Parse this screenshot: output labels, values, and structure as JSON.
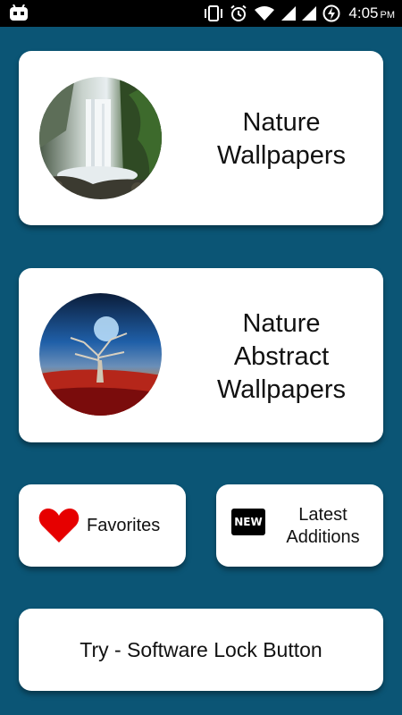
{
  "status_bar": {
    "time": "4:05",
    "ampm": "PM",
    "icons": [
      "android-debug-icon",
      "vibrate-icon",
      "alarm-icon",
      "wifi-icon",
      "signal-icon",
      "signal-icon",
      "battery-charging-icon"
    ]
  },
  "cards": {
    "nature": {
      "title_lines": [
        "Nature",
        "Wallpapers"
      ],
      "thumb": "waterfall-thumbnail"
    },
    "abstract": {
      "title_lines": [
        "Nature",
        "Abstract",
        "Wallpapers"
      ],
      "thumb": "abstract-tree-thumbnail"
    },
    "favorites": {
      "label": "Favorites",
      "icon": "heart-icon"
    },
    "latest": {
      "label_lines": [
        "Latest",
        "Additions"
      ],
      "icon": "new-badge-icon",
      "badge_text": "NEW"
    },
    "lock": {
      "label": "Try - Software Lock Button"
    }
  },
  "colors": {
    "background": "#0b5575",
    "card": "#ffffff",
    "heart": "#e60000"
  }
}
